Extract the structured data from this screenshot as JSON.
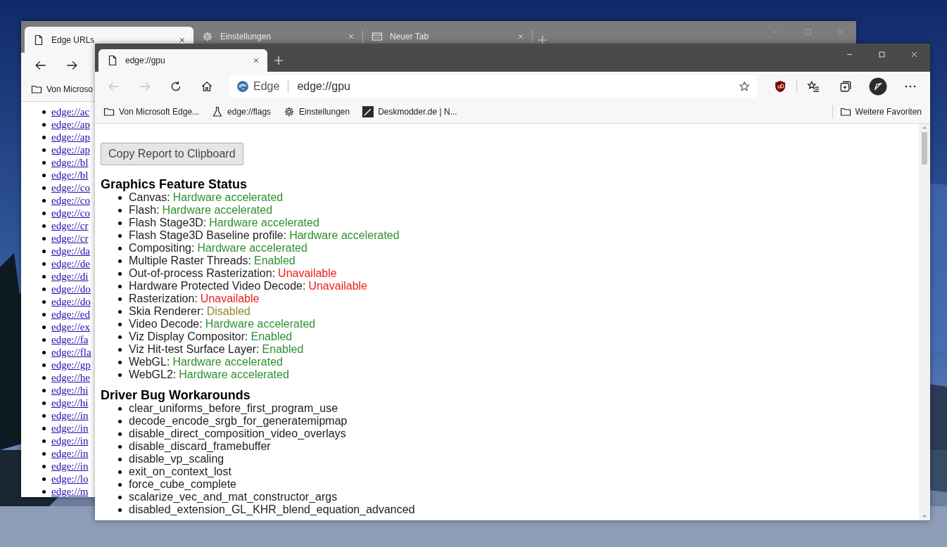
{
  "back_window": {
    "tabs": [
      {
        "title": "Edge URLs",
        "selected": true
      },
      {
        "title": "Einstellungen",
        "selected": false
      },
      {
        "title": "Neuer Tab",
        "selected": false
      }
    ],
    "bookmark": "Von Microso",
    "links": [
      "edge://ac",
      "edge://ap",
      "edge://ap",
      "edge://ap",
      "edge://bl",
      "edge://bl",
      "edge://co",
      "edge://co",
      "edge://co",
      "edge://cr",
      "edge://cr",
      "edge://da",
      "edge://de",
      "edge://di",
      "edge://do",
      "edge://do",
      "edge://ed",
      "edge://ex",
      "edge://fa",
      "edge://fla",
      "edge://gp",
      "edge://he",
      "edge://hi",
      "edge://hi",
      "edge://in",
      "edge://in",
      "edge://in",
      "edge://in",
      "edge://in",
      "edge://lo",
      "edge://m"
    ]
  },
  "front_window": {
    "tabs": [
      {
        "title": "edge://gpu",
        "selected": true
      }
    ],
    "nav": [
      {
        "kind": "back",
        "disabled": true
      },
      {
        "kind": "forward",
        "disabled": true
      },
      {
        "kind": "refresh",
        "disabled": false
      },
      {
        "kind": "home",
        "disabled": false
      }
    ],
    "address": {
      "label": "Edge",
      "url": "edge://gpu"
    },
    "bookmarks": [
      {
        "label": "Von Microsoft Edge...",
        "kind": "folder"
      },
      {
        "label": "edge://flags",
        "kind": "flask"
      },
      {
        "label": "Einstellungen",
        "kind": "gear"
      },
      {
        "label": "Deskmodder.de | N...",
        "kind": "site"
      }
    ],
    "other_bookmarks": "Weitere Favoriten",
    "copy_button": "Copy Report to Clipboard",
    "sections": [
      {
        "heading": "Graphics Feature Status",
        "items": [
          {
            "name": "Canvas:",
            "status": "Hardware accelerated",
            "color": "#2f8f2f"
          },
          {
            "name": "Flash:",
            "status": "Hardware accelerated",
            "color": "#2f8f2f"
          },
          {
            "name": "Flash Stage3D:",
            "status": "Hardware accelerated",
            "color": "#2f8f2f"
          },
          {
            "name": "Flash Stage3D Baseline profile:",
            "status": "Hardware accelerated",
            "color": "#2f8f2f"
          },
          {
            "name": "Compositing:",
            "status": "Hardware accelerated",
            "color": "#2f8f2f"
          },
          {
            "name": "Multiple Raster Threads:",
            "status": "Enabled",
            "color": "#2f8f2f"
          },
          {
            "name": "Out-of-process Rasterization:",
            "status": "Unavailable",
            "color": "#ee1c1c"
          },
          {
            "name": "Hardware Protected Video Decode:",
            "status": "Unavailable",
            "color": "#ee1c1c"
          },
          {
            "name": "Rasterization:",
            "status": "Unavailable",
            "color": "#ee1c1c"
          },
          {
            "name": "Skia Renderer:",
            "status": "Disabled",
            "color": "#8f8a2a"
          },
          {
            "name": "Video Decode:",
            "status": "Hardware accelerated",
            "color": "#2f8f2f"
          },
          {
            "name": "Viz Display Compositor:",
            "status": "Enabled",
            "color": "#2f8f2f"
          },
          {
            "name": "Viz Hit-test Surface Layer:",
            "status": "Enabled",
            "color": "#2f8f2f"
          },
          {
            "name": "WebGL:",
            "status": "Hardware accelerated",
            "color": "#2f8f2f"
          },
          {
            "name": "WebGL2:",
            "status": "Hardware accelerated",
            "color": "#2f8f2f"
          }
        ]
      },
      {
        "heading": "Driver Bug Workarounds",
        "items": [
          {
            "name": "clear_uniforms_before_first_program_use"
          },
          {
            "name": "decode_encode_srgb_for_generatemipmap"
          },
          {
            "name": "disable_direct_composition_video_overlays"
          },
          {
            "name": "disable_discard_framebuffer"
          },
          {
            "name": "disable_vp_scaling"
          },
          {
            "name": "exit_on_context_lost"
          },
          {
            "name": "force_cube_complete"
          },
          {
            "name": "scalarize_vec_and_mat_constructor_args"
          },
          {
            "name": "disabled_extension_GL_KHR_blend_equation_advanced"
          }
        ]
      }
    ]
  }
}
